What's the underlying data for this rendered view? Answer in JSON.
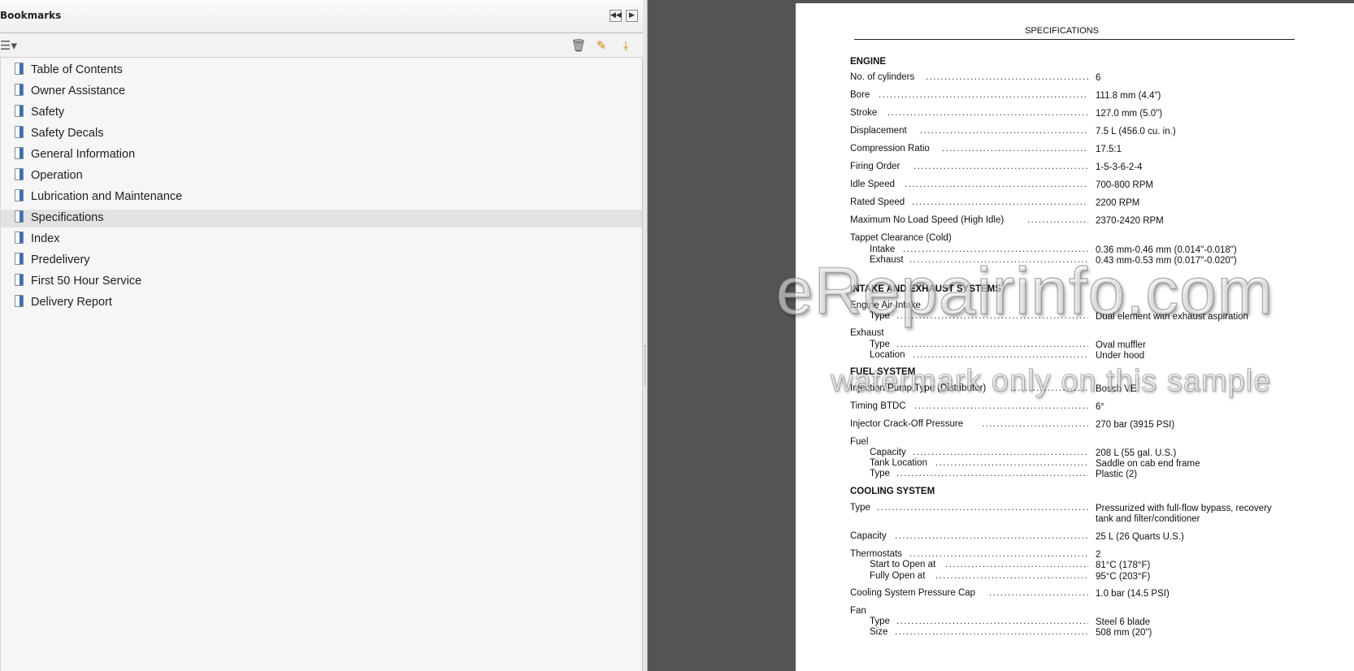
{
  "bookmarks": {
    "title": "Bookmarks",
    "header_buttons": {
      "collapse": "◀◀",
      "expand": "▶"
    },
    "toolbar_icons": [
      "options-menu-icon",
      "delete-bookmark-icon",
      "new-bookmark-icon",
      "expand-bookmark-icon"
    ],
    "selected": "Specifications",
    "items": [
      "Table of Contents",
      "Owner Assistance",
      "Safety",
      "Safety Decals",
      "General Information",
      "Operation",
      "Lubrication and Maintenance",
      "Specifications",
      "Index",
      "Predelivery",
      "First 50 Hour Service",
      "Delivery Report"
    ]
  },
  "page": {
    "title": "SPECIFICATIONS",
    "sections": {
      "engine": "ENGINE",
      "intake": "INTAKE AND EXHAUST SYSTEMS",
      "fuel": "FUEL SYSTEM",
      "cooling": "COOLING SYSTEM"
    },
    "specs": {
      "cylinders": {
        "label": "No. of cylinders",
        "value": "6"
      },
      "bore": {
        "label": "Bore",
        "value": "111.8 mm (4.4\")"
      },
      "stroke": {
        "label": "Stroke",
        "value": "127.0 mm (5.0\")"
      },
      "displacement": {
        "label": "Displacement",
        "value": "7.5 L (456.0 cu. in.)"
      },
      "compression": {
        "label": "Compression Ratio",
        "value": "17.5:1"
      },
      "firing": {
        "label": "Firing Order",
        "value": "1-5-3-6-2-4"
      },
      "idle": {
        "label": "Idle Speed",
        "value": "700-800 RPM"
      },
      "rated": {
        "label": "Rated Speed",
        "value": "2200 RPM"
      },
      "max_no_load": {
        "label": "Maximum No Load Speed (High Idle)",
        "value": "2370-2420 RPM"
      },
      "tappet": {
        "label": "Tappet Clearance (Cold)"
      },
      "tappet_intake": {
        "label": "Intake",
        "value": "0.36 mm-0.46 mm (0.014\"-0.018\")"
      },
      "tappet_exhaust": {
        "label": "Exhaust",
        "value": "0.43 mm-0.53 mm (0.017\"-0.020\")"
      },
      "air_intake": {
        "label": "Engine Air Intake"
      },
      "air_intake_type": {
        "label": "Type",
        "value": "Dual element with exhaust aspiration"
      },
      "exhaust": {
        "label": "Exhaust"
      },
      "exhaust_type": {
        "label": "Type",
        "value": "Oval muffler"
      },
      "exhaust_location": {
        "label": "Location",
        "value": "Under hood"
      },
      "injection_pump": {
        "label": "Injection Pump Type (Distributor)",
        "value": "Bosch VE"
      },
      "timing": {
        "label": "Timing BTDC",
        "value": "6°"
      },
      "injector": {
        "label": "Injector Crack-Off Pressure",
        "value": "270 bar (3915 PSI)"
      },
      "fuel": {
        "label": "Fuel"
      },
      "fuel_capacity": {
        "label": "Capacity",
        "value": "208 L (55 gal. U.S.)"
      },
      "fuel_tank_location": {
        "label": "Tank Location",
        "value": "Saddle on cab end frame"
      },
      "fuel_type": {
        "label": "Type",
        "value": "Plastic (2)"
      },
      "cool_type": {
        "label": "Type",
        "value_1": "Pressurized with full-flow bypass, recovery",
        "value_2": "tank and filter/conditioner"
      },
      "cool_capacity": {
        "label": "Capacity",
        "value": "25 L (26 Quarts U.S.)"
      },
      "thermostats": {
        "label": "Thermostats",
        "value": "2"
      },
      "start_open": {
        "label": "Start to Open at",
        "value": "81°C (178°F)"
      },
      "fully_open": {
        "label": "Fully Open at",
        "value": "95°C (203°F)"
      },
      "pressure_cap": {
        "label": "Cooling System Pressure Cap",
        "value": "1.0 bar (14.5 PSI)"
      },
      "fan": {
        "label": "Fan"
      },
      "fan_type": {
        "label": "Type",
        "value": "Steel 6 blade"
      },
      "fan_size": {
        "label": "Size",
        "value": "508 mm (20\")"
      }
    }
  },
  "watermark": {
    "line1": "eRepairinfo.com",
    "line2": "watermark only on this sample"
  }
}
